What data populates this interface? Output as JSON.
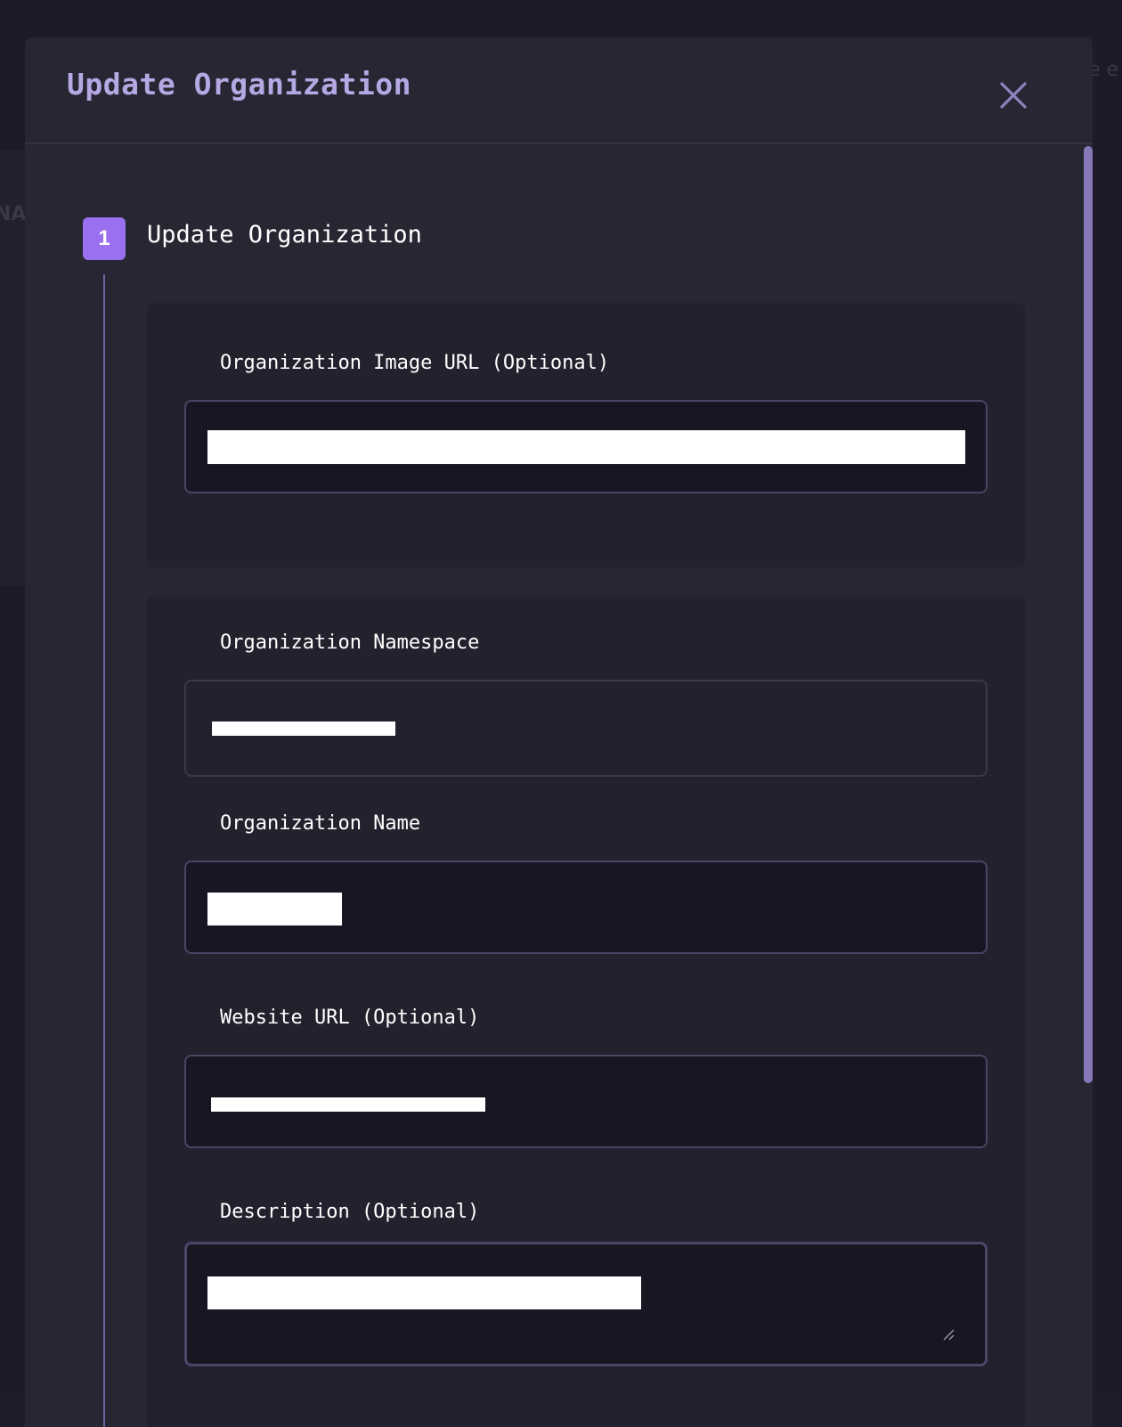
{
  "modal": {
    "title": "Update Organization",
    "close_label": "close"
  },
  "step": {
    "number": "1",
    "title": "Update Organization"
  },
  "fields": {
    "image_url": {
      "label": "Organization Image URL (Optional)",
      "value": ""
    },
    "namespace": {
      "label": "Organization Namespace",
      "value": ""
    },
    "name": {
      "label": "Organization Name",
      "value": ""
    },
    "website": {
      "label": "Website URL (Optional)",
      "value": ""
    },
    "description": {
      "label": "Description (Optional)",
      "value": ""
    }
  },
  "background": {
    "left_fragment": "NA",
    "right_fragment": "e e"
  },
  "colors": {
    "accent": "#9a6ff0",
    "title": "#b6a8e3",
    "modal_bg": "#272633",
    "input_bg": "#171623",
    "scrollbar": "#8778b8"
  }
}
